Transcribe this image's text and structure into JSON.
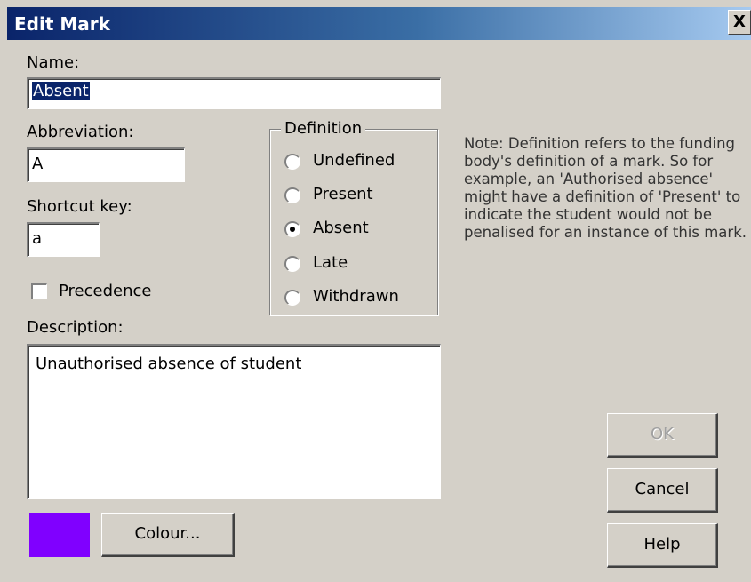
{
  "window": {
    "title": "Edit Mark",
    "close_label": "X"
  },
  "name": {
    "label": "Name:",
    "value": "Absent"
  },
  "abbreviation": {
    "label": "Abbreviation:",
    "value": "A"
  },
  "shortcut": {
    "label": "Shortcut key:",
    "value": "a"
  },
  "precedence": {
    "label": "Precedence",
    "checked": false
  },
  "definition": {
    "legend": "Definition",
    "options": [
      "Undefined",
      "Present",
      "Absent",
      "Late",
      "Withdrawn"
    ],
    "selected": "Absent"
  },
  "note": "Note: Definition refers to the funding body's definition of a mark. So for example, an 'Authorised absence' might have a definition of 'Present' to indicate the student would not be penalised for an instance of this mark.",
  "description": {
    "label": "Description:",
    "value": "Unauthorised absence of student"
  },
  "colour": {
    "swatch": "#8000ff",
    "button_label": "Colour..."
  },
  "buttons": {
    "ok": "OK",
    "cancel": "Cancel",
    "help": "Help"
  }
}
